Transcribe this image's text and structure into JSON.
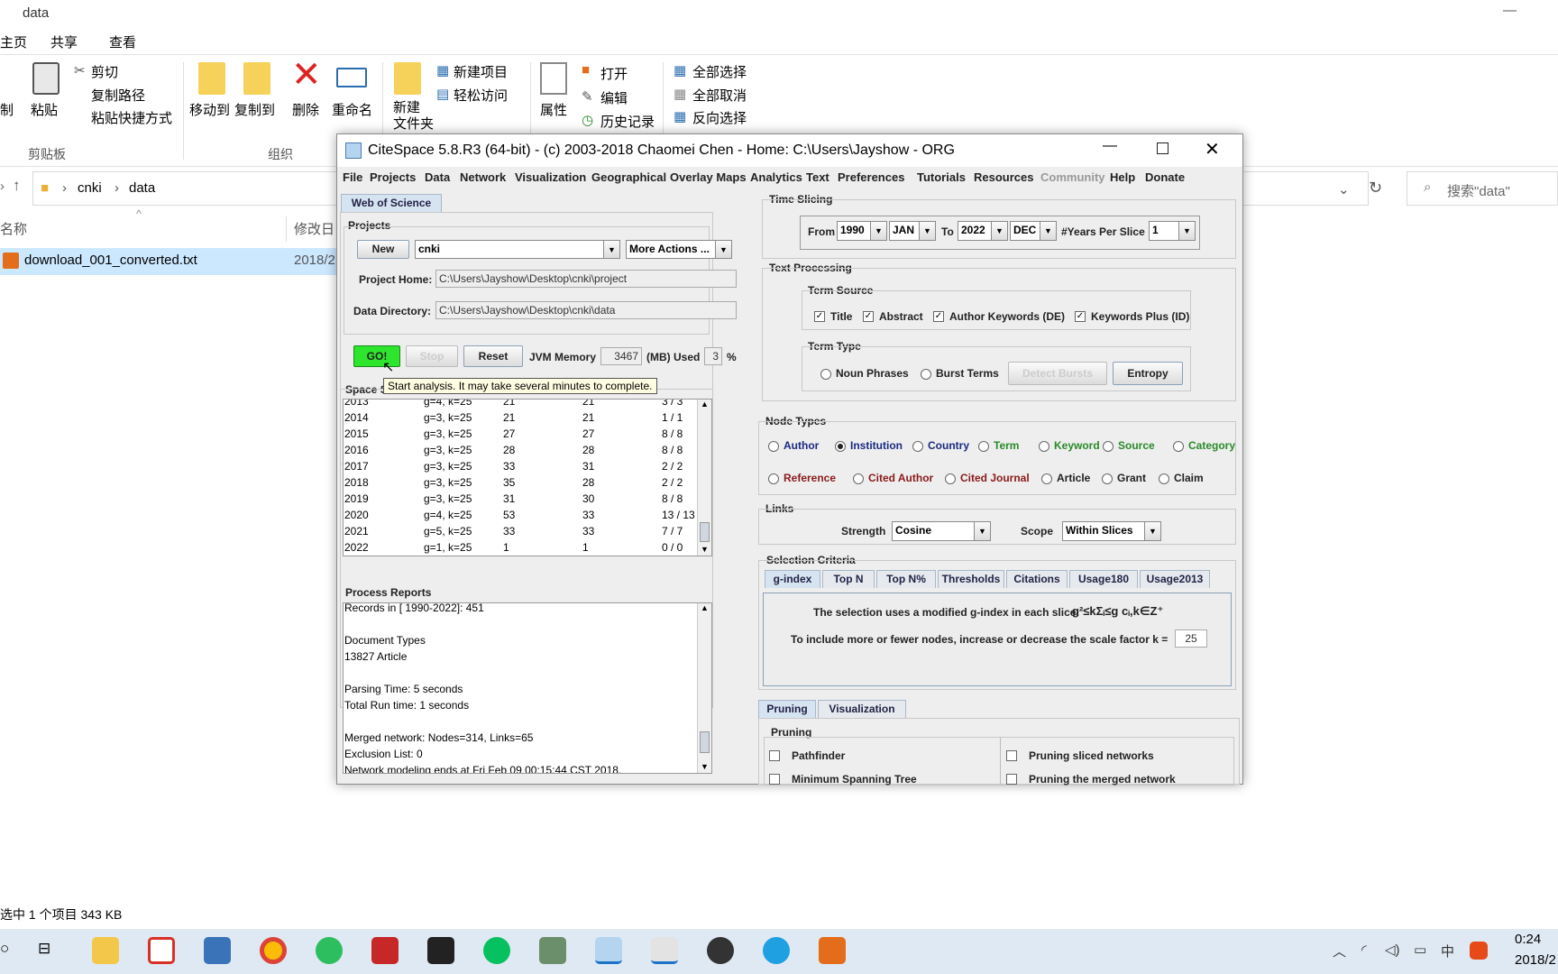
{
  "explorer": {
    "title": "data",
    "tabs": [
      "主页",
      "共享",
      "查看"
    ],
    "ribbon": {
      "copy": "制",
      "paste": "粘贴",
      "cut": "剪切",
      "copy_path": "复制路径",
      "paste_shortcut": "粘贴快捷方式",
      "clipboard_group": "剪贴板",
      "move_to": "移动到",
      "copy_to": "复制到",
      "delete": "删除",
      "rename": "重命名",
      "organize_group": "组织",
      "new_folder": "新建\n文件夹",
      "new_item": "新建项目",
      "easy_access": "轻松访问",
      "properties": "属性",
      "open": "打开",
      "edit": "编辑",
      "history": "历史记录",
      "select_all": "全部选择",
      "select_none": "全部取消",
      "invert_selection": "反向选择"
    },
    "breadcrumb": [
      "cnki",
      "data"
    ],
    "search_placeholder": "搜索\"data\"",
    "col_name": "名称",
    "col_modified": "修改日",
    "file_name": "download_001_converted.txt",
    "file_date": "2018/2",
    "status": "选中 1 个项目  343 KB"
  },
  "taskbar": {
    "time": "0:24",
    "date": "2018/2",
    "ime": "中"
  },
  "citespace": {
    "title": "CiteSpace 5.8.R3 (64-bit) - (c) 2003-2018 Chaomei Chen - Home: C:\\Users\\Jayshow - ORG",
    "menu": [
      "File",
      "Projects",
      "Data",
      "Network",
      "Visualization",
      "Geographical",
      "Overlay Maps",
      "Analytics",
      "Text",
      "Preferences",
      "Tutorials",
      "Resources",
      "Community",
      "Help",
      "Donate"
    ],
    "source_tab": "Web of Science",
    "projects_label": "Projects",
    "new_btn": "New",
    "project": "cnki",
    "more_actions": "More Actions ...",
    "project_home_label": "Project Home:",
    "project_home": "C:\\Users\\Jayshow\\Desktop\\cnki\\project",
    "data_dir_label": "Data Directory:",
    "data_dir": "C:\\Users\\Jayshow\\Desktop\\cnki\\data",
    "go": "GO!",
    "stop": "Stop",
    "reset": "Reset",
    "jvm_label": "JVM Memory",
    "jvm_value": "3467",
    "used_label": "(MB) Used",
    "used_value": "3",
    "pct": "%",
    "tooltip": "Start analysis. It may take several minutes to complete.",
    "space_label": "Space S",
    "slices": [
      [
        "2013",
        "g=4, k=25",
        "21",
        "21",
        "3 / 3"
      ],
      [
        "2014",
        "g=3, k=25",
        "21",
        "21",
        "1 / 1"
      ],
      [
        "2015",
        "g=3, k=25",
        "27",
        "27",
        "8 / 8"
      ],
      [
        "2016",
        "g=3, k=25",
        "28",
        "28",
        "8 / 8"
      ],
      [
        "2017",
        "g=3, k=25",
        "33",
        "31",
        "2 / 2"
      ],
      [
        "2018",
        "g=3, k=25",
        "35",
        "28",
        "2 / 2"
      ],
      [
        "2019",
        "g=3, k=25",
        "31",
        "30",
        "8 / 8"
      ],
      [
        "2020",
        "g=4, k=25",
        "53",
        "33",
        "13 / 13"
      ],
      [
        "2021",
        "g=5, k=25",
        "33",
        "33",
        "7 / 7"
      ],
      [
        "2022",
        "g=1, k=25",
        "1",
        "1",
        "0 / 0"
      ]
    ],
    "process_label": "Process Reports",
    "process_lines": [
      "Records in [ 1990-2022]: 451",
      "",
      "Document Types",
      "13827          Article",
      "",
      "Parsing Time:   5 seconds",
      "Total Run time:  1 seconds",
      "",
      "Merged network: Nodes=314, Links=65",
      "Exclusion List: 0",
      "Network modeling ends at Fri Feb 09 00:15:44 CST 2018."
    ],
    "time_slicing_label": "Time Slicing",
    "from": "From",
    "from_year": "1990",
    "from_month": "JAN",
    "to": "To",
    "to_year": "2022",
    "to_month": "DEC",
    "years_per_slice_label": "#Years Per Slice",
    "years_per_slice": "1",
    "text_processing_label": "Text Processing",
    "term_source_label": "Term Source",
    "term_sources": [
      "Title",
      "Abstract",
      "Author Keywords (DE)",
      "Keywords Plus (ID)"
    ],
    "term_type_label": "Term Type",
    "noun_phrases": "Noun Phrases",
    "burst_terms": "Burst Terms",
    "detect_bursts": "Detect Bursts",
    "entropy": "Entropy",
    "node_types_label": "Node Types",
    "node_types_row1": [
      "Author",
      "Institution",
      "Country",
      "Term",
      "Keyword",
      "Source",
      "Category"
    ],
    "node_types_row2": [
      "Reference",
      "Cited Author",
      "Cited Journal",
      "Article",
      "Grant",
      "Claim"
    ],
    "links_label": "Links",
    "strength_label": "Strength",
    "strength": "Cosine",
    "scope_label": "Scope",
    "scope": "Within Slices",
    "selection_label": "Selection Criteria",
    "sel_tabs": [
      "g-index",
      "Top N",
      "Top N%",
      "Thresholds",
      "Citations",
      "Usage180",
      "Usage2013"
    ],
    "gindex_text": "The selection uses a modified g-index in each slice:",
    "formula": "g²≤kΣᵢ≤g cᵢ,k∈Z⁺",
    "scale_text": "To include more or fewer nodes, increase or decrease the scale factor k =",
    "scale_k": "25",
    "bottom_tabs": [
      "Pruning",
      "Visualization"
    ],
    "pruning_label": "Pruning",
    "prune_opts": [
      "Pathfinder",
      "Pruning sliced networks",
      "Minimum Spanning Tree",
      "Pruning the merged network"
    ]
  }
}
